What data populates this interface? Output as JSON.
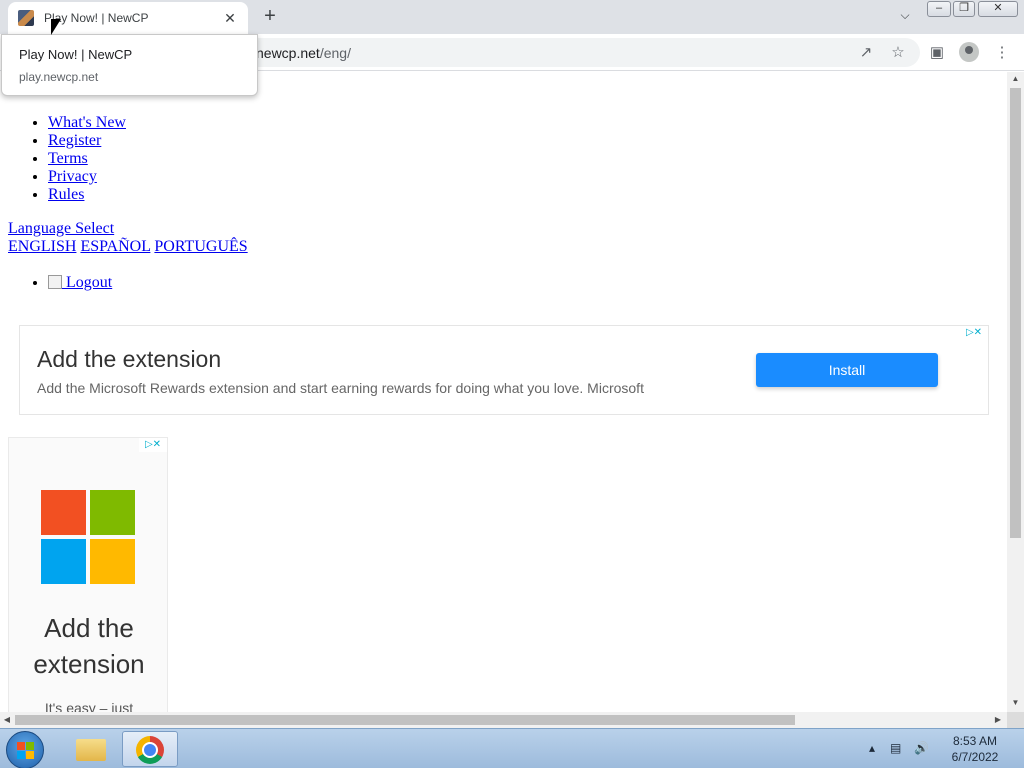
{
  "browser": {
    "tab_title": "Play Now! | NewCP",
    "new_tab": "+",
    "tab_close": "✕",
    "url_host": "newcp.net",
    "url_path": "/eng/",
    "hover_title": "Play Now! | NewCP",
    "hover_url": "play.newcp.net",
    "window_controls": [
      "minimize",
      "restore",
      "close"
    ]
  },
  "nav": {
    "items": [
      "What's New",
      "Register",
      "Terms",
      "Privacy",
      "Rules"
    ]
  },
  "language": {
    "label": "Language Select",
    "options": [
      "ENGLISH",
      "ESPAÑOL",
      "PORTUGUÊS"
    ]
  },
  "account": {
    "logout_label": " Logout"
  },
  "ad_banner": {
    "headline": "Add the extension",
    "subtext": "Add the Microsoft Rewards extension and start earning rewards for doing what you love. Microsoft",
    "button": "Install"
  },
  "ad_side": {
    "headline": "Add the extension",
    "subtext": "It's easy – just",
    "logo_colors": [
      "#f25022",
      "#7fba00",
      "#00a4ef",
      "#ffb900"
    ]
  },
  "taskbar": {
    "time": "8:53 AM",
    "date": "6/7/2022"
  }
}
